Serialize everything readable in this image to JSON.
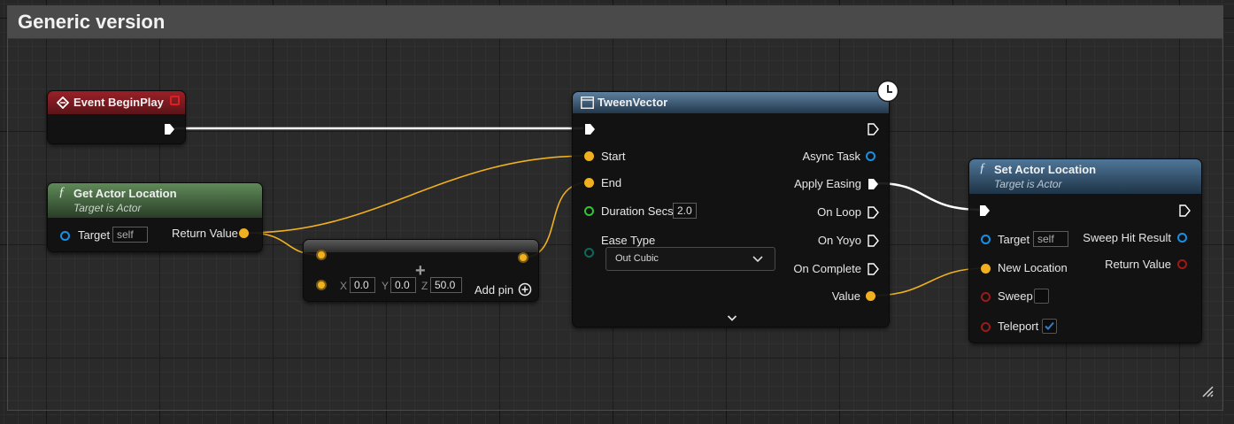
{
  "comment": {
    "title": "Generic version"
  },
  "event_begin_play": {
    "title": "Event BeginPlay"
  },
  "get_actor_location": {
    "title": "Get Actor Location",
    "subtitle": "Target is Actor",
    "target_label": "Target",
    "target_value": "self",
    "return_label": "Return Value"
  },
  "make_vector": {
    "x_label": "X",
    "x_value": "0.0",
    "y_label": "Y",
    "y_value": "0.0",
    "z_label": "Z",
    "z_value": "50.0",
    "add_pin_label": "Add pin"
  },
  "tween_vector": {
    "title": "TweenVector",
    "start_label": "Start",
    "end_label": "End",
    "duration_label": "Duration Secs",
    "duration_value": "2.0",
    "ease_label": "Ease Type",
    "ease_value": "Out Cubic",
    "async_task_label": "Async Task",
    "apply_easing_label": "Apply Easing",
    "on_loop_label": "On Loop",
    "on_yoyo_label": "On Yoyo",
    "on_complete_label": "On Complete",
    "value_label": "Value"
  },
  "set_actor_location": {
    "title": "Set Actor Location",
    "subtitle": "Target is Actor",
    "target_label": "Target",
    "target_value": "self",
    "new_location_label": "New Location",
    "sweep_label": "Sweep",
    "sweep_checked": false,
    "teleport_label": "Teleport",
    "teleport_checked": true,
    "sweep_hit_label": "Sweep Hit Result",
    "return_label": "Return Value"
  },
  "colors": {
    "event_header": "#8a1c22",
    "function_header": "#4a6e45",
    "latent_header": "#3a5670",
    "set_header": "#2f4f68",
    "exec_wire": "#ffffff",
    "vector_wire": "#f0b020",
    "object_pin": "#1a8fe0",
    "bool_pin": "#a01818",
    "float_pin": "#36c236",
    "checkbox_accent": "#2a7fd0"
  },
  "icons": {
    "event": "event-diamond-icon",
    "function": "function-f-icon",
    "latent": "clock-icon",
    "expand": "chevron-down-icon",
    "add": "plus-circle-icon"
  }
}
